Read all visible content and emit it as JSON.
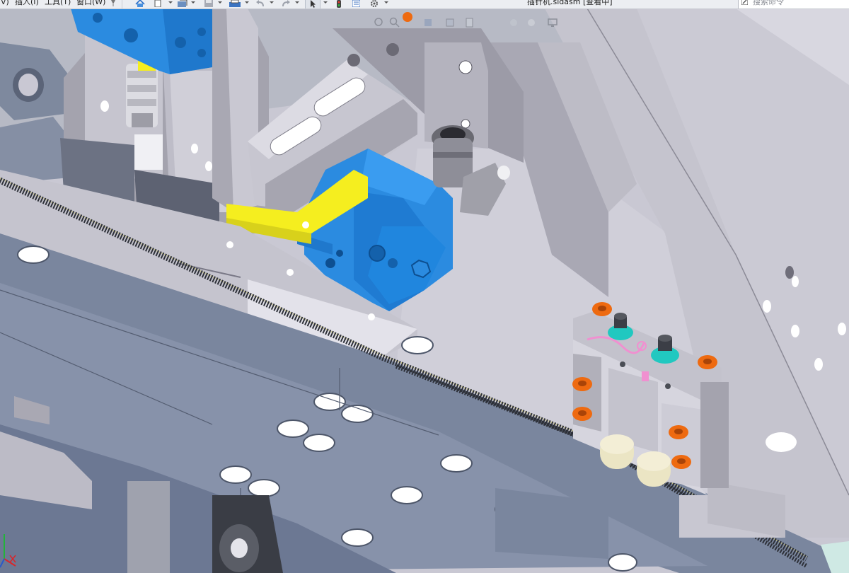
{
  "menu": {
    "items": [
      {
        "label": "V)"
      },
      {
        "label": "插入(I)"
      },
      {
        "label": "工具(T)"
      },
      {
        "label": "窗口(W)"
      }
    ]
  },
  "toolbar": {
    "buttons": [
      {
        "icon": "home-icon"
      },
      {
        "icon": "new-document-icon"
      },
      {
        "icon": "open-icon"
      },
      {
        "icon": "save-icon"
      },
      {
        "icon": "print-icon"
      },
      {
        "icon": "undo-icon"
      },
      {
        "icon": "redo-icon"
      },
      {
        "icon": "select-icon"
      },
      {
        "icon": "rebuild-icon"
      },
      {
        "icon": "file-properties-icon"
      },
      {
        "icon": "options-icon"
      }
    ]
  },
  "window": {
    "title": "插针机.sldasm [查看中]"
  },
  "search": {
    "placeholder": "搜索命令"
  },
  "colors": {
    "accent_blue": "#2b8be0",
    "part_yellow": "#f5ee1f",
    "fastener_orange": "#ee6a10",
    "fitting_cyan": "#21c8c0",
    "part_gray": "#c8c7d1",
    "rail_gray": "#8c92a4",
    "rail_blue": "#6e7d9a"
  }
}
